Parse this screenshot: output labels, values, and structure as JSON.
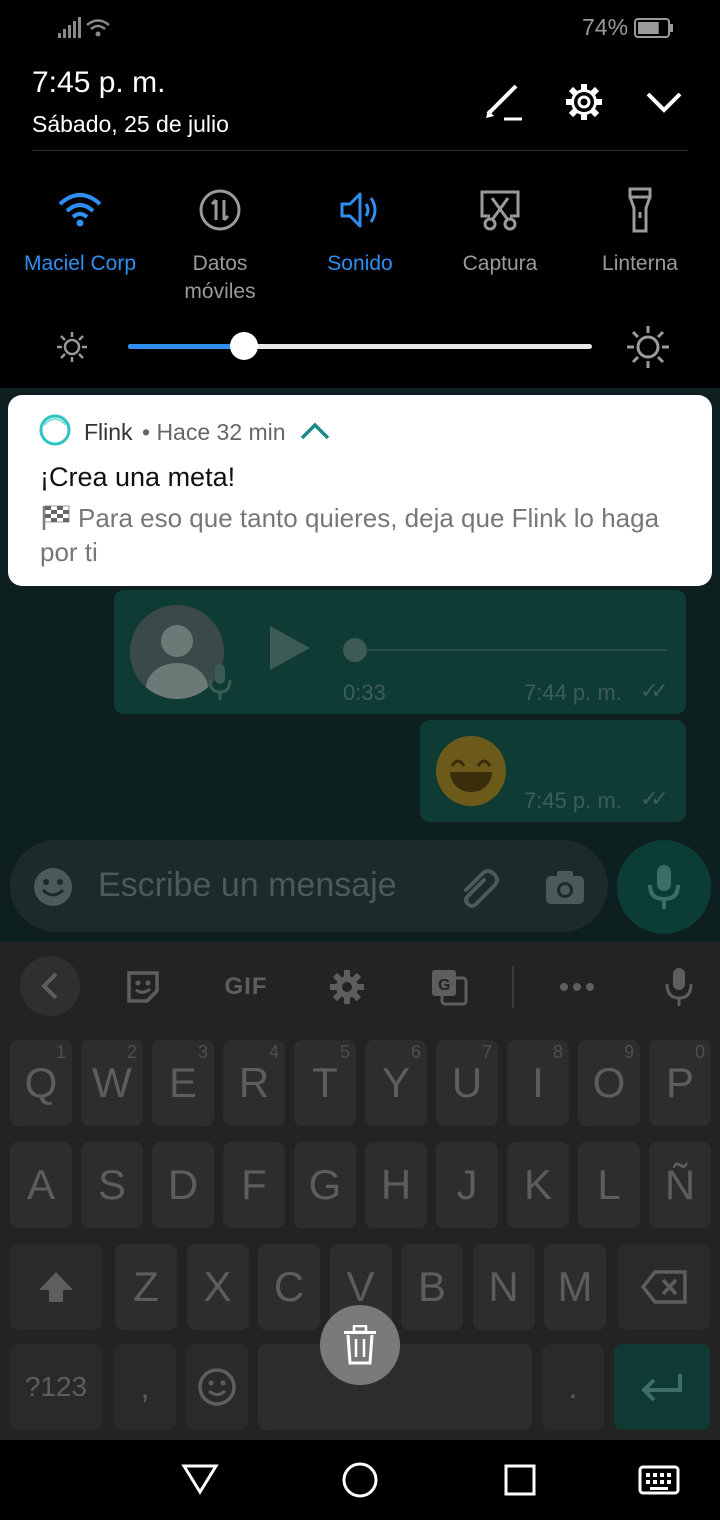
{
  "status_bar": {
    "battery_percent": "74%",
    "battery_level": 0.74
  },
  "shade": {
    "time": "7:45 p. m.",
    "date": "Sábado, 25 de julio",
    "header_icons": [
      "edit-icon",
      "settings-icon",
      "expand-icon"
    ],
    "tiles": [
      {
        "label": "Maciel Corp",
        "icon": "wifi-icon",
        "active": true
      },
      {
        "label": "Datos\nmóviles",
        "icon": "mobile-data-icon",
        "active": false
      },
      {
        "label": "Sonido",
        "icon": "volume-icon",
        "active": true
      },
      {
        "label": "Captura",
        "icon": "screenshot-icon",
        "active": false
      },
      {
        "label": "Linterna",
        "icon": "flashlight-icon",
        "active": false
      }
    ],
    "brightness_level": 0.25
  },
  "notification": {
    "app_name": "Flink",
    "meta": "• Hace 32 min",
    "title": "¡Crea una meta!",
    "body": "Para eso que tanto quieres, deja que Flink lo haga por ti"
  },
  "chat": {
    "voice_duration": "0:33",
    "voice_time": "7:44 p. m.",
    "emoji_time": "7:45 p. m.",
    "composer_placeholder": "Escribe un mensaje"
  },
  "keyboard": {
    "toolbar_gif": "GIF",
    "row1": [
      {
        "k": "Q",
        "n": "1"
      },
      {
        "k": "W",
        "n": "2"
      },
      {
        "k": "E",
        "n": "3"
      },
      {
        "k": "R",
        "n": "4"
      },
      {
        "k": "T",
        "n": "5"
      },
      {
        "k": "Y",
        "n": "6"
      },
      {
        "k": "U",
        "n": "7"
      },
      {
        "k": "I",
        "n": "8"
      },
      {
        "k": "O",
        "n": "9"
      },
      {
        "k": "P",
        "n": "0"
      }
    ],
    "row2": [
      "A",
      "S",
      "D",
      "F",
      "G",
      "H",
      "J",
      "K",
      "L",
      "Ñ"
    ],
    "row3": [
      "Z",
      "X",
      "C",
      "V",
      "B",
      "N",
      "M"
    ],
    "symbols_label": "?123",
    "comma_label": ",",
    "period_label": "."
  },
  "colors": {
    "accent": "#2e8ff0",
    "shade_bg": "#000000",
    "card_bg": "#ffffff"
  }
}
